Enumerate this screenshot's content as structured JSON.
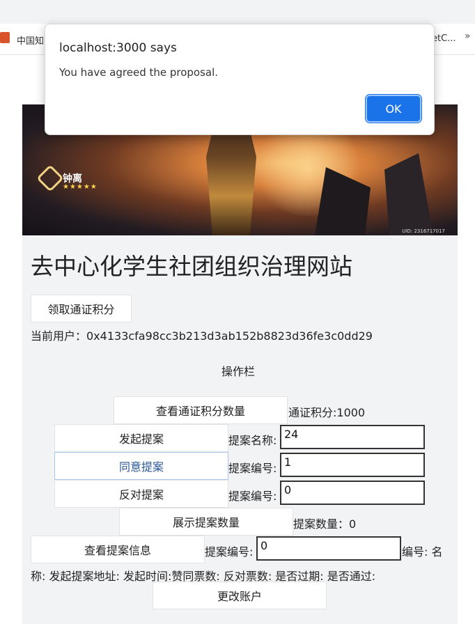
{
  "browser": {
    "bookmark_left": "中国知",
    "bookmark_right": "etC...",
    "overflow": "»"
  },
  "banner": {
    "character_name": "钟离",
    "stars": "★★★★★",
    "watermark": "UID: 2316717017"
  },
  "page": {
    "title": "去中心化学生社团组织治理网站",
    "claim_button": "领取通证积分",
    "current_user": "当前用户：0x4133cfa98cc3b213d3ab152b8823d36fe3c0dd29",
    "section_title": "操作栏",
    "view_points_button": "查看通证积分数量",
    "points_label": "通证积分:1000",
    "create_proposal_button": "发起提案",
    "proposal_name_label": "提案名称:",
    "proposal_name_value": "24",
    "agree_button": "同意提案",
    "agree_id_label": "提案编号:",
    "agree_id_value": "1",
    "oppose_button": "反对提案",
    "oppose_id_label": "提案编号:",
    "oppose_id_value": "0",
    "show_count_button": "展示提案数量",
    "count_label": "提案数量：0",
    "view_info_button": "查看提案信息",
    "info_id_label": "提案编号:",
    "info_id_value": "0",
    "info_trailing": "编号: 名",
    "info_line": "称: 发起提案地址: 发起时间:赞同票数: 反对票数: 是否过期: 是否通过:",
    "change_account_button": "更改账户"
  },
  "dialog": {
    "origin": "localhost:3000 says",
    "message": "You have agreed the proposal.",
    "ok_label": "OK"
  }
}
